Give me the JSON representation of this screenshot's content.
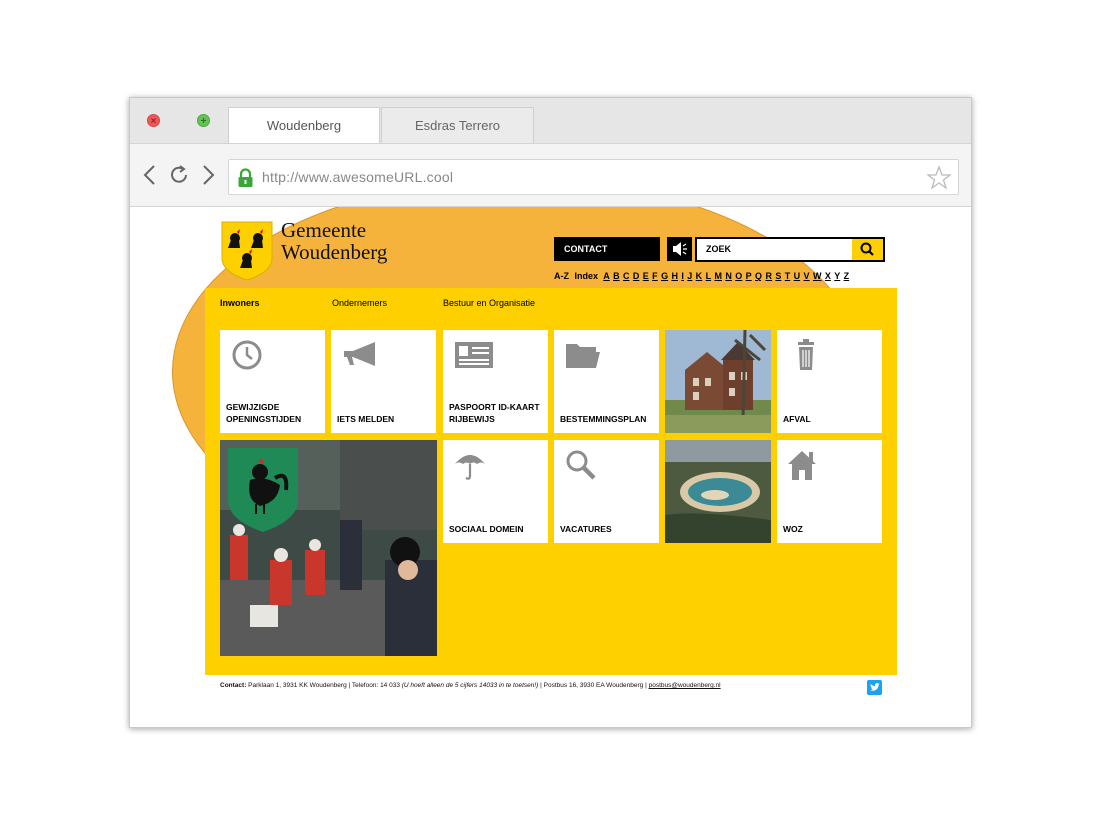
{
  "browser": {
    "tabs": [
      {
        "label": "Woudenberg",
        "active": true
      },
      {
        "label": "Esdras Terrero",
        "active": false
      }
    ],
    "url": "http://www.awesomeURL.cool"
  },
  "site": {
    "brand_line1": "Gemeente",
    "brand_line2": "Woudenberg",
    "contact_label": "CONTACT",
    "search_placeholder": "ZOEK",
    "az": {
      "label1": "A-Z",
      "label2": "Index",
      "letters": [
        "A",
        "B",
        "C",
        "D",
        "E",
        "F",
        "G",
        "H",
        "I",
        "J",
        "K",
        "L",
        "M",
        "N",
        "O",
        "P",
        "Q",
        "R",
        "S",
        "T",
        "U",
        "V",
        "W",
        "X",
        "Y",
        "Z"
      ]
    },
    "main_nav": [
      "Inwoners",
      "Ondernemers",
      "Bestuur en Organisatie"
    ],
    "tiles": [
      {
        "label": "GEWIJZIGDE OPENINGSTIJDEN",
        "icon": "clock-icon"
      },
      {
        "label": "IETS MELDEN",
        "icon": "megaphone-icon"
      },
      {
        "label": "PASPOORT ID-KAART RIJBEWIJS",
        "icon": "id-card-icon"
      },
      {
        "label": "BESTEMMINGSPLAN",
        "icon": "folder-icon"
      },
      {
        "label": "AFVAL",
        "icon": "trash-icon"
      },
      {
        "label": "SOCIAAL DOMEIN",
        "icon": "umbrella-icon"
      },
      {
        "label": "VACATURES",
        "icon": "magnifier-icon"
      },
      {
        "label": "WOZ",
        "icon": "house-icon"
      }
    ],
    "footer": {
      "contact_label": "Contact:",
      "address": " Parklaan 1, 3931 KK Woudenberg | Telefoon: 14 033 ",
      "note": "(U hoeft alleen de 5 cijfers 14033 in te toetsen!)",
      "postbus": " | Postbus 16, 3930 EA Woudenberg | ",
      "email": "postbus@woudenberg.nl"
    }
  },
  "colors": {
    "accent": "#ffd000",
    "tile_icon": "#8c8c8c"
  }
}
